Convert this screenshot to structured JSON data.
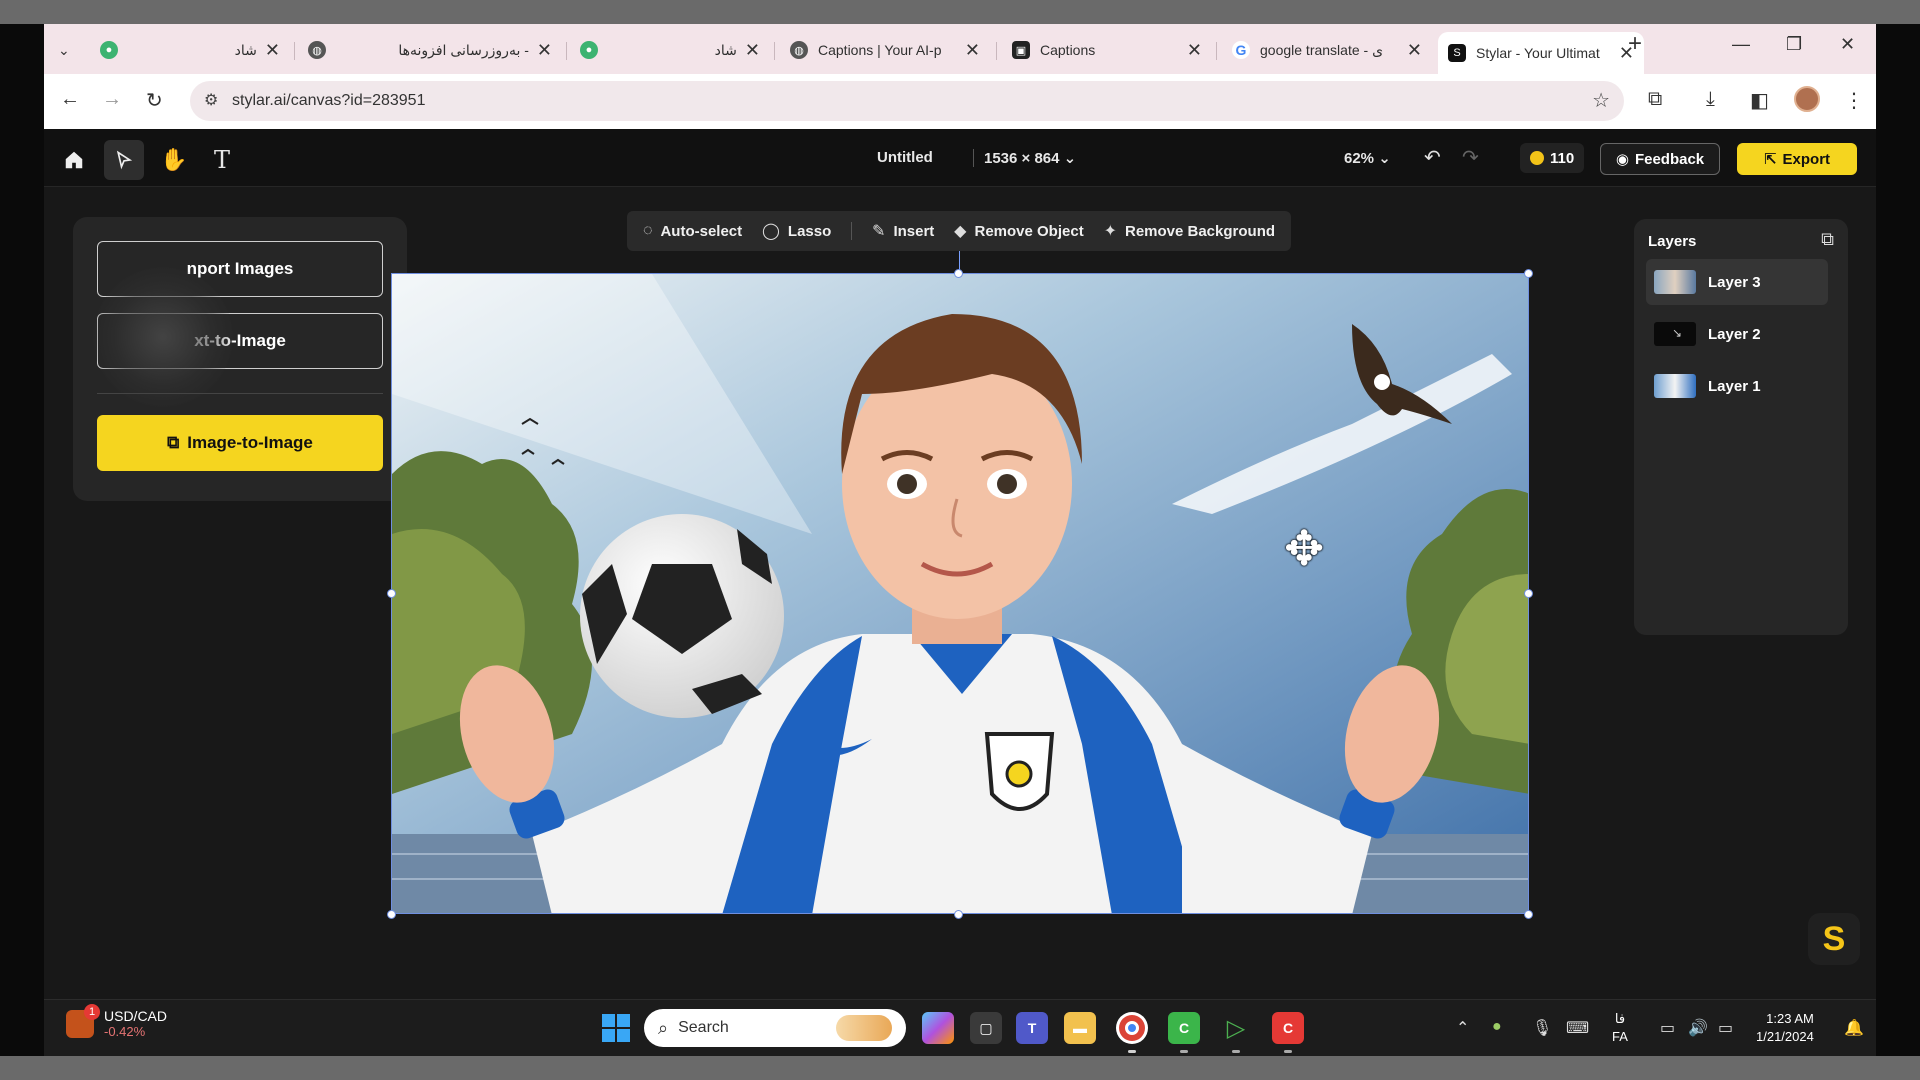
{
  "browser": {
    "tabs": [
      {
        "title": "شاد",
        "icon": "green-chat-icon",
        "active": false
      },
      {
        "title": "به‌روزرسانی افزونه‌ها -",
        "icon": "globe-icon",
        "active": false
      },
      {
        "title": "شاد",
        "icon": "green-chat-icon",
        "active": false
      },
      {
        "title": "Captions | Your AI-p",
        "icon": "globe-icon",
        "active": false
      },
      {
        "title": "Captions",
        "icon": "captions-icon",
        "active": false
      },
      {
        "title": "google translate - ی",
        "icon": "google-icon",
        "active": false
      },
      {
        "title": "Stylar - Your Ultimat",
        "icon": "stylar-icon",
        "active": true
      }
    ],
    "url": "stylar.ai/canvas?id=283951"
  },
  "app": {
    "doc_title": "Untitled",
    "doc_size": "1536 × 864",
    "zoom": "62%",
    "credits": "110",
    "feedback_label": "Feedback",
    "export_label": "Export",
    "generate": {
      "import_label": "nport Images",
      "text_to_image_label": "xt-to-Image",
      "image_to_image_label": "Image-to-Image"
    },
    "edit_tools": {
      "auto_select": "Auto-select",
      "lasso": "Lasso",
      "insert": "Insert",
      "remove_object": "Remove Object",
      "remove_background": "Remove Background"
    },
    "layers": {
      "title": "Layers",
      "items": [
        "Layer 3",
        "Layer 2",
        "Layer 1"
      ],
      "selected": "Layer 3"
    },
    "accent_color": "#f5d51f"
  },
  "taskbar": {
    "ticker": "USD/CAD",
    "ticker_change": "-0.42%",
    "notification_count": "1",
    "search_placeholder": "Search",
    "lang_top": "فا",
    "lang_bottom": "FA",
    "time": "1:23 AM",
    "date": "1/21/2024"
  }
}
